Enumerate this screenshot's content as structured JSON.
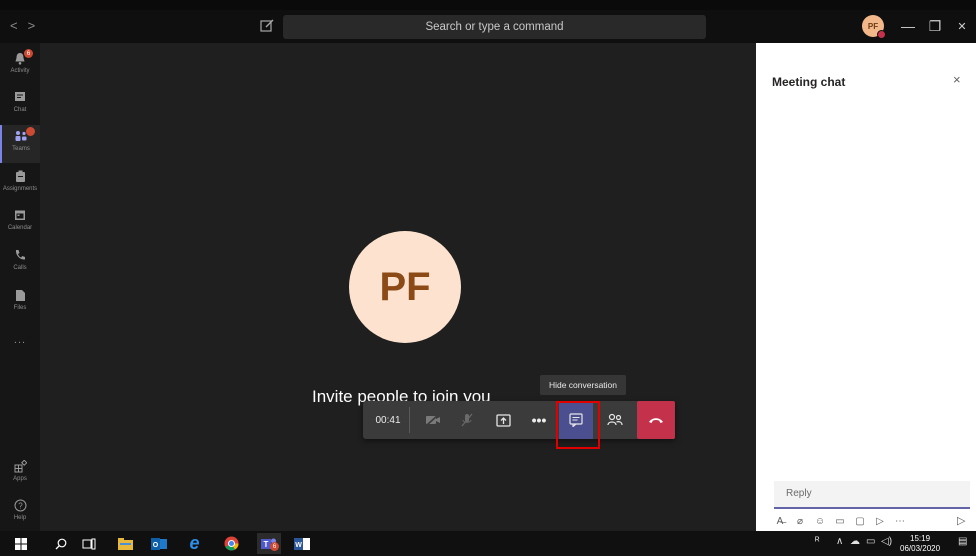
{
  "titlebar": {
    "nav_back": "<",
    "nav_forward": ">",
    "search_placeholder": "Search or type a command",
    "user_initials": "PF",
    "minimize": "—",
    "maximize": "❐",
    "close": "✕"
  },
  "rail": {
    "items": [
      {
        "label": "Activity",
        "icon": "bell-icon",
        "badge": "6"
      },
      {
        "label": "Chat",
        "icon": "chat-icon"
      },
      {
        "label": "Teams",
        "icon": "teams-icon",
        "badge": ""
      },
      {
        "label": "Assignments",
        "icon": "assignments-icon"
      },
      {
        "label": "Calendar",
        "icon": "calendar-icon"
      },
      {
        "label": "Calls",
        "icon": "phone-icon"
      },
      {
        "label": "Files",
        "icon": "files-icon"
      },
      {
        "label": "...",
        "icon": "more-icon"
      },
      {
        "label": "Apps",
        "icon": "apps-icon"
      },
      {
        "label": "Help",
        "icon": "help-icon"
      }
    ]
  },
  "stage": {
    "avatar_initials": "PF",
    "invite_text": "Invite people to join you",
    "tooltip": "Hide conversation"
  },
  "callbar": {
    "timer": "00:41",
    "buttons": [
      "camera-off",
      "mic-off",
      "share-screen",
      "more",
      "conversation",
      "participants",
      "hang-up"
    ]
  },
  "panel": {
    "title": "Meeting chat",
    "close": "×",
    "reply_placeholder": "Reply"
  },
  "taskbar": {
    "clock_time": "15:19",
    "clock_date": "06/03/2020",
    "teams_badge": "6"
  },
  "colors": {
    "accent": "#6264a7",
    "hangup": "#c4314b",
    "highlight": "#e00000"
  }
}
